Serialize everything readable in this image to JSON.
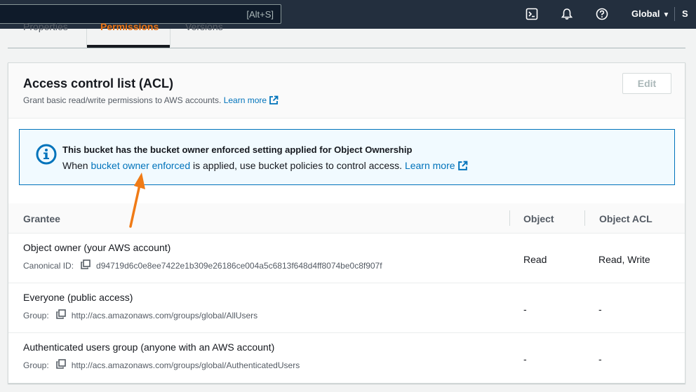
{
  "topnav": {
    "search_shortcut": "[Alt+S]",
    "region_label": "Global",
    "more_label": "S",
    "icons": [
      "cloudshell-icon",
      "bell-icon",
      "help-icon",
      "caret-down-icon"
    ]
  },
  "tabs": [
    {
      "label": "Properties"
    },
    {
      "label": "Permissions",
      "active": true
    },
    {
      "label": "Versions"
    }
  ],
  "acl_panel": {
    "title": "Access control list (ACL)",
    "description": "Grant basic read/write permissions to AWS accounts.",
    "learn_more": "Learn more",
    "edit_label": "Edit"
  },
  "alert": {
    "title": "This bucket has the bucket owner enforced setting applied for Object Ownership",
    "body_prefix": "When",
    "body_link": "bucket owner enforced",
    "body_suffix": "is applied, use bucket policies to control access.",
    "learn_more": "Learn more"
  },
  "table": {
    "columns": [
      "Grantee",
      "Object",
      "Object ACL"
    ],
    "rows": [
      {
        "grantee": "Object owner (your AWS account)",
        "id_label": "Canonical ID:",
        "id_value": "d94719d6c0e8ee7422e1b309e26186ce004a5c6813f648d4ff8074be0c8f907f",
        "object": "Read",
        "object_acl": "Read, Write"
      },
      {
        "grantee": "Everyone (public access)",
        "id_label": "Group:",
        "id_value": "http://acs.amazonaws.com/groups/global/AllUsers",
        "object": "-",
        "object_acl": "-"
      },
      {
        "grantee": "Authenticated users group (anyone with an AWS account)",
        "id_label": "Group:",
        "id_value": "http://acs.amazonaws.com/groups/global/AuthenticatedUsers",
        "object": "-",
        "object_acl": "-"
      }
    ]
  },
  "colors": {
    "nav_bg": "#232f3e",
    "link": "#0073bb",
    "active_tab": "#ec7211",
    "annotation_arrow": "#f07b16",
    "alert_bg": "#f1faff"
  }
}
